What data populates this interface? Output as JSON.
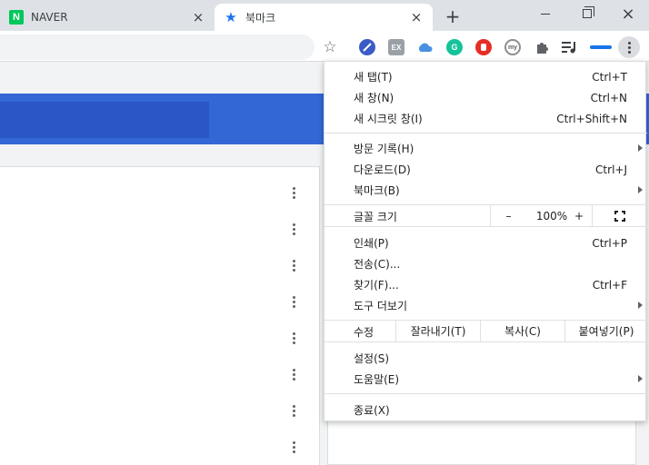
{
  "tabs": [
    {
      "title": "NAVER",
      "favicon": "naver-icon",
      "active": false
    },
    {
      "title": "북마크",
      "favicon": "star-icon",
      "active": true
    }
  ],
  "icons": {
    "close": "×",
    "new_tab": "+",
    "star": "☆",
    "tab_star": "★",
    "naver_letter": "N"
  },
  "toolbar": {
    "extensions": [
      {
        "name": "blue-shield-extension-icon",
        "color": "#3b5cc7"
      },
      {
        "name": "ex-extension-icon",
        "color": "#9aa0a6",
        "text": "EX"
      },
      {
        "name": "cloud-extension-icon",
        "color": "#4a90e2"
      },
      {
        "name": "grammarly-extension-icon",
        "color": "#15c39a",
        "text": "G"
      },
      {
        "name": "stop-hand-extension-icon",
        "color": "#e52d27"
      },
      {
        "name": "my-extension-icon",
        "color": "#8d8d8d",
        "text": "my"
      },
      {
        "name": "puzzle-extension-icon",
        "color": "#5f6368"
      },
      {
        "name": "media-playlist-extension-icon",
        "color": "#3c4043"
      },
      {
        "name": "wordmark-extension-icon",
        "color": "#1a73e8"
      }
    ]
  },
  "menu": {
    "new_tab": {
      "label": "새 탭(T)",
      "shortcut": "Ctrl+T"
    },
    "new_window": {
      "label": "새 창(N)",
      "shortcut": "Ctrl+N"
    },
    "incognito": {
      "label": "새 시크릿 창(I)",
      "shortcut": "Ctrl+Shift+N"
    },
    "history": {
      "label": "방문 기록(H)"
    },
    "downloads": {
      "label": "다운로드(D)",
      "shortcut": "Ctrl+J"
    },
    "bookmarks": {
      "label": "북마크(B)"
    },
    "zoom": {
      "label": "글꼴 크기",
      "minus": "–",
      "value": "100%",
      "plus": "+"
    },
    "print": {
      "label": "인쇄(P)",
      "shortcut": "Ctrl+P"
    },
    "cast": {
      "label": "전송(C)..."
    },
    "find": {
      "label": "찾기(F)...",
      "shortcut": "Ctrl+F"
    },
    "more_tools": {
      "label": "도구 더보기"
    },
    "edit": {
      "label": "수정",
      "cut": "잘라내기(T)",
      "copy": "복사(C)",
      "paste": "붙여넣기(P)"
    },
    "settings": {
      "label": "설정(S)"
    },
    "help": {
      "label": "도움말(E)"
    },
    "exit": {
      "label": "종료(X)"
    }
  },
  "colors": {
    "accent_blue": "#3367d6",
    "search_blue": "#2a56c6"
  }
}
